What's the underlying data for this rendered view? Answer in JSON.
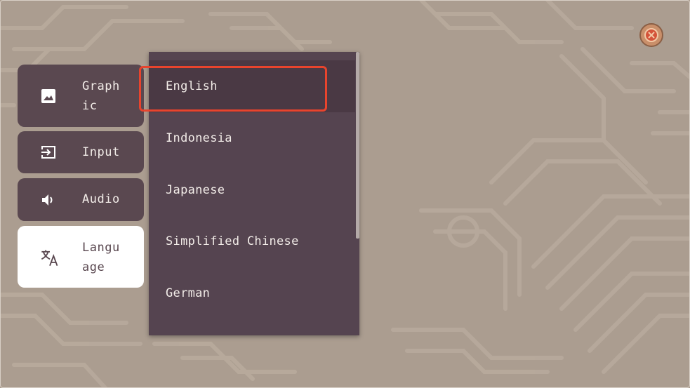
{
  "settings_tabs": [
    {
      "label": "Graphic",
      "icon": "image-icon",
      "active": false
    },
    {
      "label": "Input",
      "icon": "input-icon",
      "active": false
    },
    {
      "label": "Audio",
      "icon": "speaker-icon",
      "active": false
    },
    {
      "label": "Language",
      "icon": "translate-icon",
      "active": true
    }
  ],
  "language_dropdown": {
    "selected": "English",
    "options": [
      "English",
      "Indonesia",
      "Japanese",
      "Simplified Chinese",
      "German"
    ]
  },
  "close_button": {
    "icon": "close-icon"
  },
  "colors": {
    "background": "#ab9d90",
    "panel": "#5a4850",
    "dropdown": "#554450",
    "highlight": "#e8442d",
    "active_tab": "#ffffff"
  }
}
